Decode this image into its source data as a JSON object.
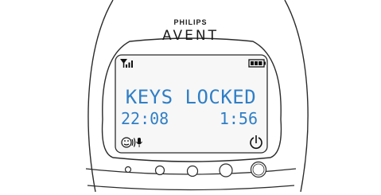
{
  "brand": {
    "top": "PHILIPS",
    "main": "AVENT"
  },
  "screen": {
    "status": "KEYS LOCKED",
    "clock": "22:08",
    "timer": "1:56"
  },
  "icons": {
    "signal": "signal-strength-icon",
    "battery": "battery-icon",
    "talk": "talk-face-icon",
    "mic": "microphone-icon",
    "timer": "timer-icon"
  },
  "colors": {
    "lcd_text": "#2f7fc7",
    "lcd_background": "#f7f7f7",
    "outline": "#2b2b2b"
  }
}
